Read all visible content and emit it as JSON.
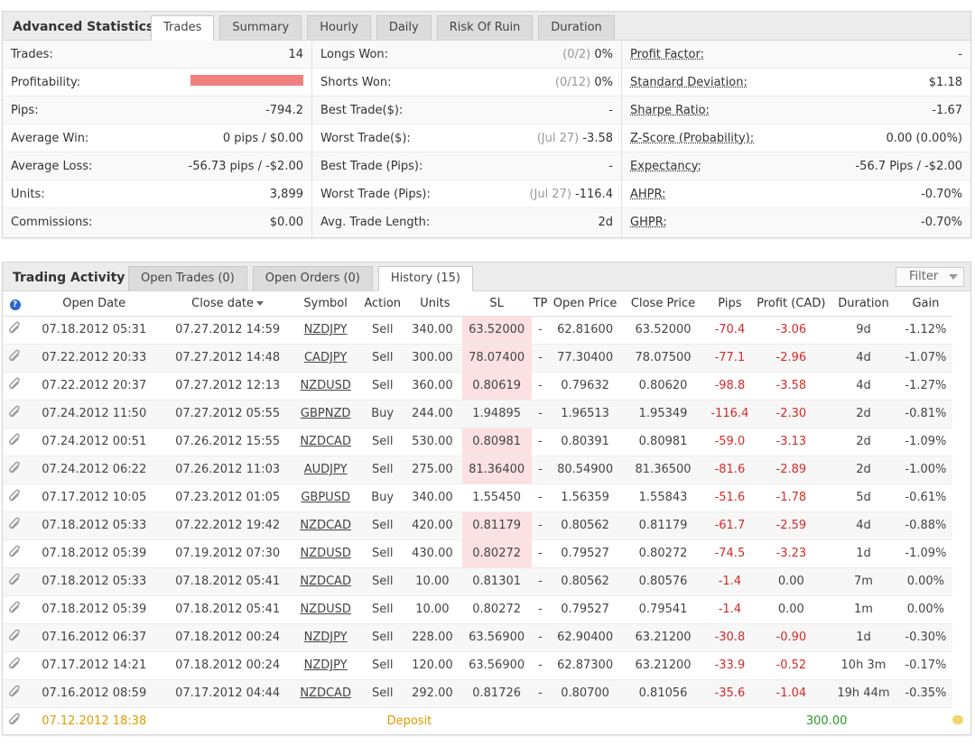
{
  "stats": {
    "title": "Advanced Statistics",
    "tabs": [
      "Trades",
      "Summary",
      "Hourly",
      "Daily",
      "Risk Of Ruin",
      "Duration"
    ],
    "active_tab": 0,
    "col_a": [
      {
        "label": "Trades:",
        "value": "14"
      },
      {
        "label": "Profitability:",
        "value": "",
        "bar_fraction": 1.0,
        "bar_color": "#f08080"
      },
      {
        "label": "Pips:",
        "value": "-794.2"
      },
      {
        "label": "Average Win:",
        "value": "0 pips / $0.00"
      },
      {
        "label": "Average Loss:",
        "value": "-56.73 pips / -$2.00"
      },
      {
        "label": "Units:",
        "value": "3,899"
      },
      {
        "label": "Commissions:",
        "value": "$0.00"
      }
    ],
    "col_b": [
      {
        "label": "Longs Won:",
        "muted": "(0/2)",
        "value": "0%"
      },
      {
        "label": "Shorts Won:",
        "muted": "(0/12)",
        "value": "0%"
      },
      {
        "label": "Best Trade($):",
        "muted": "",
        "value": "-"
      },
      {
        "label": "Worst Trade($):",
        "muted": "(Jul 27)",
        "value": "-3.58"
      },
      {
        "label": "Best Trade (Pips):",
        "muted": "",
        "value": "-"
      },
      {
        "label": "Worst Trade (Pips):",
        "muted": "(Jul 27)",
        "value": "-116.4"
      },
      {
        "label": "Avg. Trade Length:",
        "muted": "",
        "value": "2d"
      }
    ],
    "col_c": [
      {
        "label": "Profit Factor:",
        "value": "-"
      },
      {
        "label": "Standard Deviation:",
        "value": "$1.18"
      },
      {
        "label": "Sharpe Ratio:",
        "value": "-1.67"
      },
      {
        "label": "Z-Score (Probability):",
        "value": "0.00 (0.00%)"
      },
      {
        "label": "Expectancy:",
        "value": "-56.7 Pips / -$2.00"
      },
      {
        "label": "AHPR:",
        "value": "-0.70%"
      },
      {
        "label": "GHPR:",
        "value": "-0.70%"
      }
    ]
  },
  "activity": {
    "title": "Trading Activity",
    "tabs": [
      "Open Trades (0)",
      "Open Orders (0)",
      "History (15)"
    ],
    "active_tab": 2,
    "filter_label": "Filter",
    "columns": [
      "Open Date",
      "Close date",
      "Symbol",
      "Action",
      "Units",
      "SL",
      "TP",
      "Open Price",
      "Close Price",
      "Pips",
      "Profit (CAD)",
      "Duration",
      "Gain"
    ],
    "rows": [
      {
        "open": "07.18.2012 05:31",
        "close": "07.27.2012 14:59",
        "symbol": "NZDJPY",
        "action": "Sell",
        "units": "340.00",
        "sl": "63.52000",
        "sl_hit": true,
        "tp": "-",
        "open_price": "62.81600",
        "close_price": "63.52000",
        "pips": "-70.4",
        "profit": "-3.06",
        "duration": "9d",
        "gain": "-1.12%"
      },
      {
        "open": "07.22.2012 20:33",
        "close": "07.27.2012 14:48",
        "symbol": "CADJPY",
        "action": "Sell",
        "units": "300.00",
        "sl": "78.07400",
        "sl_hit": true,
        "tp": "-",
        "open_price": "77.30400",
        "close_price": "78.07500",
        "pips": "-77.1",
        "profit": "-2.96",
        "duration": "4d",
        "gain": "-1.07%"
      },
      {
        "open": "07.22.2012 20:37",
        "close": "07.27.2012 12:13",
        "symbol": "NZDUSD",
        "action": "Sell",
        "units": "360.00",
        "sl": "0.80619",
        "sl_hit": true,
        "tp": "-",
        "open_price": "0.79632",
        "close_price": "0.80620",
        "pips": "-98.8",
        "profit": "-3.58",
        "duration": "4d",
        "gain": "-1.27%"
      },
      {
        "open": "07.24.2012 11:50",
        "close": "07.27.2012 05:55",
        "symbol": "GBPNZD",
        "action": "Buy",
        "units": "244.00",
        "sl": "1.94895",
        "sl_hit": false,
        "tp": "-",
        "open_price": "1.96513",
        "close_price": "1.95349",
        "pips": "-116.4",
        "profit": "-2.30",
        "duration": "2d",
        "gain": "-0.81%"
      },
      {
        "open": "07.24.2012 00:51",
        "close": "07.26.2012 15:55",
        "symbol": "NZDCAD",
        "action": "Sell",
        "units": "530.00",
        "sl": "0.80981",
        "sl_hit": true,
        "tp": "-",
        "open_price": "0.80391",
        "close_price": "0.80981",
        "pips": "-59.0",
        "profit": "-3.13",
        "duration": "2d",
        "gain": "-1.09%"
      },
      {
        "open": "07.24.2012 06:22",
        "close": "07.26.2012 11:03",
        "symbol": "AUDJPY",
        "action": "Sell",
        "units": "275.00",
        "sl": "81.36400",
        "sl_hit": true,
        "tp": "-",
        "open_price": "80.54900",
        "close_price": "81.36500",
        "pips": "-81.6",
        "profit": "-2.89",
        "duration": "2d",
        "gain": "-1.00%"
      },
      {
        "open": "07.17.2012 10:05",
        "close": "07.23.2012 01:05",
        "symbol": "GBPUSD",
        "action": "Buy",
        "units": "340.00",
        "sl": "1.55450",
        "sl_hit": false,
        "tp": "-",
        "open_price": "1.56359",
        "close_price": "1.55843",
        "pips": "-51.6",
        "profit": "-1.78",
        "duration": "5d",
        "gain": "-0.61%"
      },
      {
        "open": "07.18.2012 05:33",
        "close": "07.22.2012 19:42",
        "symbol": "NZDCAD",
        "action": "Sell",
        "units": "420.00",
        "sl": "0.81179",
        "sl_hit": true,
        "tp": "-",
        "open_price": "0.80562",
        "close_price": "0.81179",
        "pips": "-61.7",
        "profit": "-2.59",
        "duration": "4d",
        "gain": "-0.88%"
      },
      {
        "open": "07.18.2012 05:39",
        "close": "07.19.2012 07:30",
        "symbol": "NZDUSD",
        "action": "Sell",
        "units": "430.00",
        "sl": "0.80272",
        "sl_hit": true,
        "tp": "-",
        "open_price": "0.79527",
        "close_price": "0.80272",
        "pips": "-74.5",
        "profit": "-3.23",
        "duration": "1d",
        "gain": "-1.09%"
      },
      {
        "open": "07.18.2012 05:33",
        "close": "07.18.2012 05:41",
        "symbol": "NZDCAD",
        "action": "Sell",
        "units": "10.00",
        "sl": "0.81301",
        "sl_hit": false,
        "tp": "-",
        "open_price": "0.80562",
        "close_price": "0.80576",
        "pips": "-1.4",
        "profit": "0.00",
        "duration": "7m",
        "gain": "0.00%"
      },
      {
        "open": "07.18.2012 05:39",
        "close": "07.18.2012 05:41",
        "symbol": "NZDUSD",
        "action": "Sell",
        "units": "10.00",
        "sl": "0.80272",
        "sl_hit": false,
        "tp": "-",
        "open_price": "0.79527",
        "close_price": "0.79541",
        "pips": "-1.4",
        "profit": "0.00",
        "duration": "1m",
        "gain": "0.00%"
      },
      {
        "open": "07.16.2012 06:37",
        "close": "07.18.2012 00:24",
        "symbol": "NZDJPY",
        "action": "Sell",
        "units": "228.00",
        "sl": "63.56900",
        "sl_hit": false,
        "tp": "-",
        "open_price": "62.90400",
        "close_price": "63.21200",
        "pips": "-30.8",
        "profit": "-0.90",
        "duration": "1d",
        "gain": "-0.30%"
      },
      {
        "open": "07.17.2012 14:21",
        "close": "07.18.2012 00:24",
        "symbol": "NZDJPY",
        "action": "Sell",
        "units": "120.00",
        "sl": "63.56900",
        "sl_hit": false,
        "tp": "-",
        "open_price": "62.87300",
        "close_price": "63.21200",
        "pips": "-33.9",
        "profit": "-0.52",
        "duration": "10h 3m",
        "gain": "-0.17%"
      },
      {
        "open": "07.16.2012 08:59",
        "close": "07.17.2012 04:44",
        "symbol": "NZDCAD",
        "action": "Sell",
        "units": "292.00",
        "sl": "0.81726",
        "sl_hit": false,
        "tp": "-",
        "open_price": "0.80700",
        "close_price": "0.81056",
        "pips": "-35.6",
        "profit": "-1.04",
        "duration": "19h 44m",
        "gain": "-0.35%"
      }
    ],
    "deposit": {
      "open": "07.12.2012 18:38",
      "action": "Deposit",
      "profit": "300.00"
    }
  },
  "colors": {
    "loss": "#d42a2a",
    "gain": "#2a9a2a",
    "deposit": "#e09a00",
    "sl_hit_bg": "#fbe1e1"
  }
}
